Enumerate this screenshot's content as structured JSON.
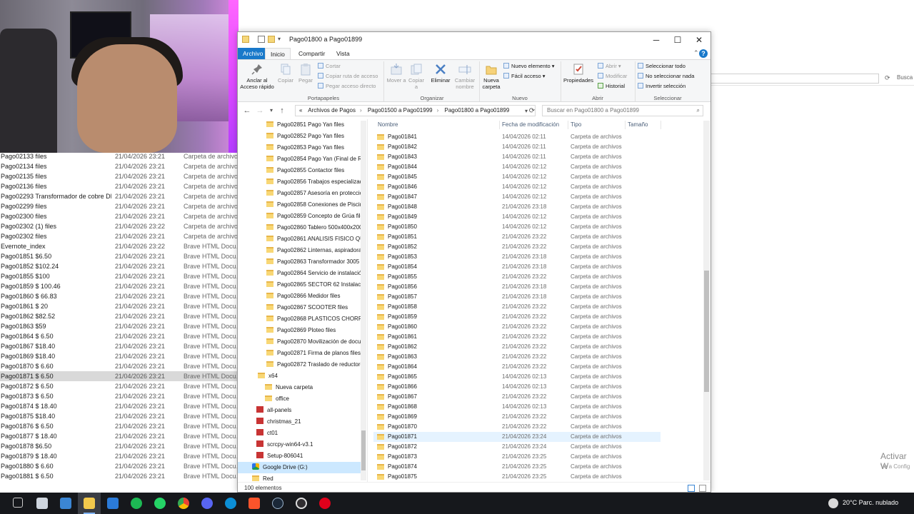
{
  "window": {
    "title": "Pago01800 a Pago01899",
    "tabs": [
      "Archivo",
      "Inicio",
      "Compartir",
      "Vista"
    ],
    "help": "?"
  },
  "ribbon": {
    "pin": "Anclar al Acceso rápido",
    "copy": "Copiar",
    "paste": "Pegar",
    "cut": "Cortar",
    "copy_path": "Copiar ruta de acceso",
    "paste_shortcut": "Pegar acceso directo",
    "group_portapapeles": "Portapapeles",
    "move": "Mover a",
    "copy_to": "Copiar a",
    "delete": "Eliminar",
    "rename": "Cambiar nombre",
    "group_organizar": "Organizar",
    "new_folder": "Nueva carpeta",
    "new_item": "Nuevo elemento",
    "easy_access": "Fácil acceso",
    "group_nuevo": "Nuevo",
    "properties": "Propiedades",
    "open": "Abrir",
    "modify": "Modificar",
    "history": "Historial",
    "group_abrir": "Abrir",
    "select_all": "Seleccionar todo",
    "select_none": "No seleccionar nada",
    "invert": "Invertir selección",
    "group_seleccionar": "Seleccionar"
  },
  "address": {
    "prefix": "«",
    "crumbs": [
      "Archivos de Pagos",
      "Pago01500 a Pago01999",
      "Pago01800 a Pago01899"
    ],
    "search_placeholder": "Buscar en Pago01800 a Pago01899"
  },
  "tree": [
    "Pago02851 Pago Yan files",
    "Pago02852 Pago Yan files",
    "Pago02853 Pago Yan files",
    "Pago02854 Pago Yan (Final de ROB",
    "Pago02855 Contactor files",
    "Pago02856 Trabajos especializados",
    "Pago02857 Asesoría en protección",
    "Pago02858 Conexiones de Piscina",
    "Pago02859 Concepto de Grúa files",
    "Pago02860 Tablero 500x400x200 , l",
    "Pago02861 ANALISIS FISICO QUIM",
    "Pago02862 Linternas, aspiradora, f",
    "Pago02863 Transformador 3005 fil",
    "Pago02864 Servicio de instalación",
    "Pago02865 SECTOR 62 Instalación",
    "Pago02866 Medidor files",
    "Pago02867 SCOOTER files",
    "Pago02868 PLASTICOS CHORRILL",
    "Pago02869 Ploteo files",
    "Pago02870 Movilización de docun",
    "Pago02871 Firma de planos files",
    "Pago02872 Traslado de reductores",
    "x64",
    "Nueva carpeta",
    "office",
    "all-panels",
    "christmas_21",
    "ct01",
    "scrcpy-win64-v3.1",
    "Setup-806041",
    "Google Drive (G:)",
    "Red"
  ],
  "list": {
    "headers": [
      "Nombre",
      "Fecha de modificación",
      "Tipo",
      "Tamaño"
    ],
    "type_label": "Carpeta de archivos",
    "rows": [
      [
        "Pago01841",
        "14/04/2026 02:11"
      ],
      [
        "Pago01842",
        "14/04/2026 02:11"
      ],
      [
        "Pago01843",
        "14/04/2026 02:11"
      ],
      [
        "Pago01844",
        "14/04/2026 02:12"
      ],
      [
        "Pago01845",
        "14/04/2026 02:12"
      ],
      [
        "Pago01846",
        "14/04/2026 02:12"
      ],
      [
        "Pago01847",
        "14/04/2026 02:12"
      ],
      [
        "Pago01848",
        "21/04/2026 23:18"
      ],
      [
        "Pago01849",
        "14/04/2026 02:12"
      ],
      [
        "Pago01850",
        "14/04/2026 02:12"
      ],
      [
        "Pago01851",
        "21/04/2026 23:22"
      ],
      [
        "Pago01852",
        "21/04/2026 23:22"
      ],
      [
        "Pago01853",
        "21/04/2026 23:18"
      ],
      [
        "Pago01854",
        "21/04/2026 23:18"
      ],
      [
        "Pago01855",
        "21/04/2026 23:22"
      ],
      [
        "Pago01856",
        "21/04/2026 23:18"
      ],
      [
        "Pago01857",
        "21/04/2026 23:18"
      ],
      [
        "Pago01858",
        "21/04/2026 23:22"
      ],
      [
        "Pago01859",
        "21/04/2026 23:22"
      ],
      [
        "Pago01860",
        "21/04/2026 23:22"
      ],
      [
        "Pago01861",
        "21/04/2026 23:22"
      ],
      [
        "Pago01862",
        "21/04/2026 23:22"
      ],
      [
        "Pago01863",
        "21/04/2026 23:22"
      ],
      [
        "Pago01864",
        "21/04/2026 23:22"
      ],
      [
        "Pago01865",
        "14/04/2026 02:13"
      ],
      [
        "Pago01866",
        "14/04/2026 02:13"
      ],
      [
        "Pago01867",
        "21/04/2026 23:22"
      ],
      [
        "Pago01868",
        "14/04/2026 02:13"
      ],
      [
        "Pago01869",
        "21/04/2026 23:22"
      ],
      [
        "Pago01870",
        "21/04/2026 23:22"
      ],
      [
        "Pago01871",
        "21/04/2026 23:24"
      ],
      [
        "Pago01872",
        "21/04/2026 23:24"
      ],
      [
        "Pago01873",
        "21/04/2026 23:25"
      ],
      [
        "Pago01874",
        "21/04/2026 23:25"
      ],
      [
        "Pago01875",
        "21/04/2026 23:25"
      ]
    ]
  },
  "status": "100 elementos",
  "background_list": [
    [
      "Pago02133 files",
      "21/04/2026 23:21",
      "Carpeta de archivos"
    ],
    [
      "Pago02134 files",
      "21/04/2026 23:21",
      "Carpeta de archivos"
    ],
    [
      "Pago02135 files",
      "21/04/2026 23:21",
      "Carpeta de archivos"
    ],
    [
      "Pago02136 files",
      "21/04/2026 23:21",
      "Carpeta de archivos"
    ],
    [
      "Pago02293 Transformador de cobre DELC...",
      "21/04/2026 23:21",
      "Carpeta de archivos"
    ],
    [
      "Pago02299 files",
      "21/04/2026 23:21",
      "Carpeta de archivos"
    ],
    [
      "Pago02300 files",
      "21/04/2026 23:21",
      "Carpeta de archivos"
    ],
    [
      "Pago02302 (1) files",
      "21/04/2026 23:22",
      "Carpeta de archivos"
    ],
    [
      "Pago02302 files",
      "21/04/2026 23:21",
      "Carpeta de archivos"
    ],
    [
      "Evernote_index",
      "21/04/2026 23:22",
      "Brave HTML Docu..."
    ],
    [
      "Pago01851 $6.50",
      "21/04/2026 23:21",
      "Brave HTML Docu..."
    ],
    [
      "Pago01852 $102.24",
      "21/04/2026 23:21",
      "Brave HTML Docu..."
    ],
    [
      "Pago01855 $100",
      "21/04/2026 23:21",
      "Brave HTML Docu..."
    ],
    [
      "Pago01859 $ 100.46",
      "21/04/2026 23:21",
      "Brave HTML Docu..."
    ],
    [
      "Pago01860 $ 66.83",
      "21/04/2026 23:21",
      "Brave HTML Docu..."
    ],
    [
      "Pago01861 $ 20",
      "21/04/2026 23:21",
      "Brave HTML Docu..."
    ],
    [
      "Pago01862 $82.52",
      "21/04/2026 23:21",
      "Brave HTML Docu..."
    ],
    [
      "Pago01863 $59",
      "21/04/2026 23:21",
      "Brave HTML Docu..."
    ],
    [
      "Pago01864 $ 6.50",
      "21/04/2026 23:21",
      "Brave HTML Docu..."
    ],
    [
      "Pago01867 $18.40",
      "21/04/2026 23:21",
      "Brave HTML Docu..."
    ],
    [
      "Pago01869 $18.40",
      "21/04/2026 23:21",
      "Brave HTML Docu..."
    ],
    [
      "Pago01870 $ 6.60",
      "21/04/2026 23:21",
      "Brave HTML Docu..."
    ],
    [
      "Pago01871 $ 6.50",
      "21/04/2026 23:21",
      "Brave HTML Docu..."
    ],
    [
      "Pago01872 $ 6.50",
      "21/04/2026 23:21",
      "Brave HTML Docu..."
    ],
    [
      "Pago01873 $ 6.50",
      "21/04/2026 23:21",
      "Brave HTML Docu..."
    ],
    [
      "Pago01874 $ 18.40",
      "21/04/2026 23:21",
      "Brave HTML Docu..."
    ],
    [
      "Pago01875 $18.40",
      "21/04/2026 23:21",
      "Brave HTML Docu..."
    ],
    [
      "Pago01876 $ 6.50",
      "21/04/2026 23:21",
      "Brave HTML Docu..."
    ],
    [
      "Pago01877 $ 18.40",
      "21/04/2026 23:21",
      "Brave HTML Docu..."
    ],
    [
      "Pago01878 $6.50",
      "21/04/2026 23:21",
      "Brave HTML Docu..."
    ],
    [
      "Pago01879 $ 18.40",
      "21/04/2026 23:21",
      "Brave HTML Docu..."
    ],
    [
      "Pago01880 $ 6.60",
      "21/04/2026 23:21",
      "Brave HTML Docu..."
    ],
    [
      "Pago01881 $ 6.50",
      "21/04/2026 23:21",
      "Brave HTML Docu..."
    ]
  ],
  "background_search": "Busca",
  "watermark": {
    "line1": "Activar W",
    "line2": "Ve a Config"
  },
  "taskbar": {
    "weather": "20°C  Parc. nublado",
    "apps": [
      "task-view",
      "file-explorer",
      "store",
      "explorer-folder",
      "mail",
      "spotify",
      "whatsapp",
      "chrome",
      "discord",
      "edge",
      "brave",
      "steam",
      "obs",
      "opera"
    ]
  }
}
